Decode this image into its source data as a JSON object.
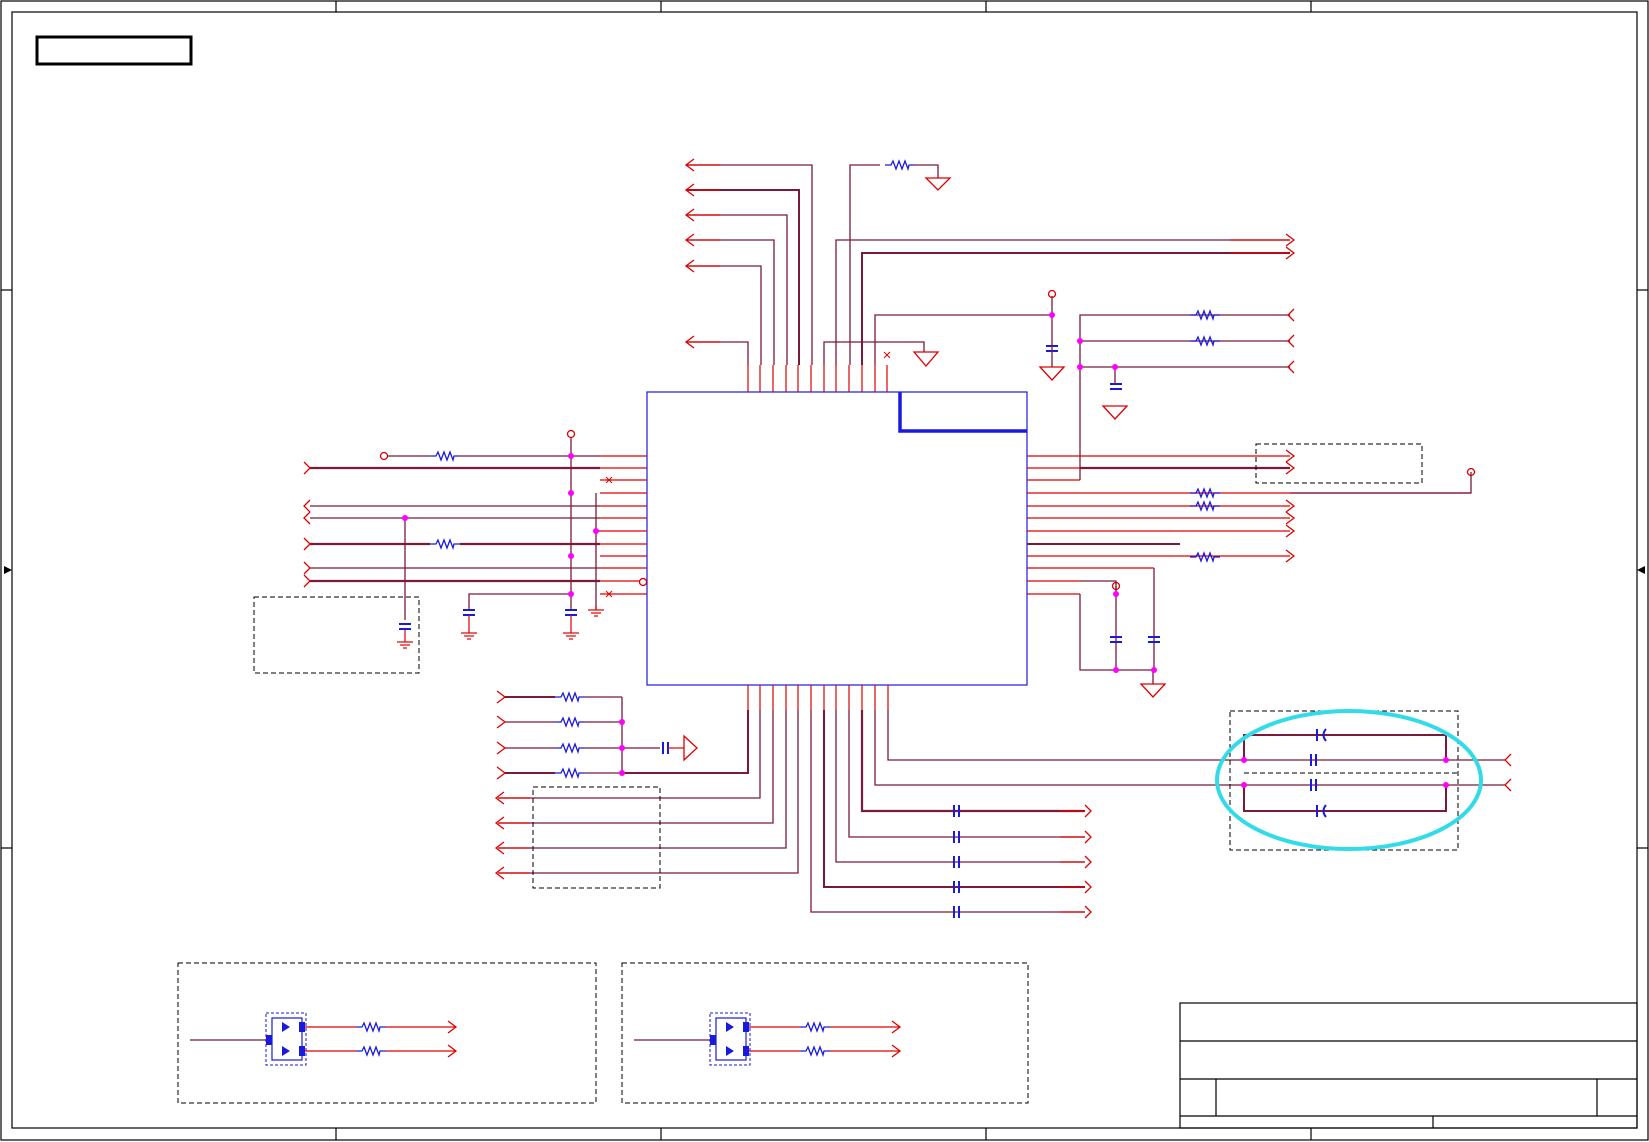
{
  "document": {
    "type": "electrical-schematic",
    "has_visible_text": false
  },
  "colors": {
    "wire": "#e00000",
    "net_dark": "#7a1a3a",
    "net_purple": "#8a2a7a",
    "component": "#1a1adc",
    "junction": "#ff00ff",
    "border": "#000000",
    "highlight": "#33dbe9",
    "dashed_box": "#000000"
  },
  "icons": [
    "resistor-icon",
    "capacitor-icon",
    "ground-icon",
    "power-rail-icon",
    "offpage-connector-icon",
    "junction-dot-icon",
    "no-connect-icon",
    "tvs-diode-array-icon"
  ]
}
